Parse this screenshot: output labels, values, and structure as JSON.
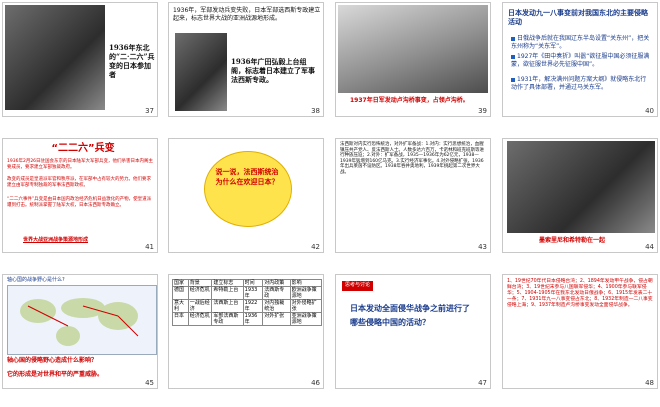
{
  "slides": [
    {
      "num": "37",
      "caption": "1936年东北的“二·二六”兵变的日本参加者"
    },
    {
      "num": "38",
      "text": "1936年，军部发动兵变失败，日本军部选西斯专政建立起来，标志世界大战的亚洲战源地形成。",
      "caption": "1936年广田弘毅上台组阁，标志着日本建立了军事法西斯专政。"
    },
    {
      "num": "39",
      "caption": "1937年日军发动卢沟桥事变，占领卢沟桥。"
    },
    {
      "num": "40",
      "title": "日本发动九一八事变前对我国东北的主要侵略活动",
      "items": [
        "日俄战争后就在我国辽东半岛设置“关东州”，把关东州称为“关东军”。",
        "1927年《田中奏折》叫嚣“欲征服中国必须征服满蒙，欲征服世界必先征服中国”。",
        "1931年，解决满州问题方案大纲》就侵略东北行动作了具体部署，并通过马关东军。"
      ]
    },
    {
      "num": "41",
      "title": "“二二六”兵变",
      "para1": "1936年2月26日驻国会东京的日本陆军大军部兵变，他们杀害日本内阁主要成员，要求建立军部独裁政府。",
      "para2": "政变的成员是皇道派军官和秩序派，在军部中占有较大的势力。他们要求建立由军部专制独裁的军事法西斯政权。",
      "para3": "“二二六事件”兵变是由日本国内政治经济危机日益激化的产物，使皇道派遭到打击。统制派掌握了陆军大权，日本法西斯专政确立。",
      "link": "世界大战亚洲战争策源地形成"
    },
    {
      "num": "42",
      "oval": "说一说，法西斯统治为什么在欢迎日本？"
    },
    {
      "num": "43",
      "para": "法西斯对内实行恐怖统治，对外扩军备战：1.对内：实行思想统治，血腥镇压共产党人、反法西斯人士。人数多达六百万，卡诺林和班克班斯等进行种族压迫；2.对外：扩军备战，1935—1936年为62亿元，1938—1939年猛增到160亿马克。3.实行经济军事化。4.对外侵略扩张，1936年出兵莱茵不设防区。1938年吞并奥地利，1939年挑起第二次世界大战。",
      "red_items": [
        "对内实行恐怖统治",
        "对外扩军备战"
      ]
    },
    {
      "num": "44",
      "caption": "墨索里尼和希特勒在一起"
    },
    {
      "num": "45",
      "top": "轴心国的战争野心是什么?",
      "bottom1": "轴心国的侵略野心造成什么影响？",
      "bottom2": "它的形成是对世界和平的严重威胁。"
    },
    {
      "num": "46",
      "headers": [
        "国家",
        "背景",
        "建立标志",
        "时间",
        "对内政策",
        "影响"
      ],
      "rows": [
        [
          "德国",
          "经济危机",
          "希特勒上台",
          "1933年",
          "法西斯专政",
          "欧洲战争策源地"
        ],
        [
          "意大利",
          "一战后经济",
          "法西斯上台",
          "1922年",
          "对内独裁统治",
          "对外侵略扩张"
        ],
        [
          "日本",
          "经济危机",
          "军部法西斯专政",
          "1936年",
          "对外扩张",
          "亚洲战争策源地"
        ]
      ]
    },
    {
      "num": "47",
      "text": "日本发动全面侵华战争之前进行了哪些侵略中国的活动？",
      "tag": "思考与讨论"
    },
    {
      "num": "48",
      "text": "1、19世纪70年代日本侵略台湾；2、1894年发动甲午战争，侵占朝鲜台湾；3、19世纪末参与八国联军侵华；4、1900年参与联军侵华；5、1904-1905年在我东北发动日俄战争；6、1915年发表二十一条；7、1931年九一八事变侵占东北；8、1932年制造一二八事变侵略上海；9、1937年制造卢沟桥事变发动全面侵华战争。"
    }
  ],
  "colors": {
    "red": "#d00000",
    "blue": "#1a3c8c",
    "oval": "#ffe34d",
    "accent": "#1f5fbf"
  }
}
